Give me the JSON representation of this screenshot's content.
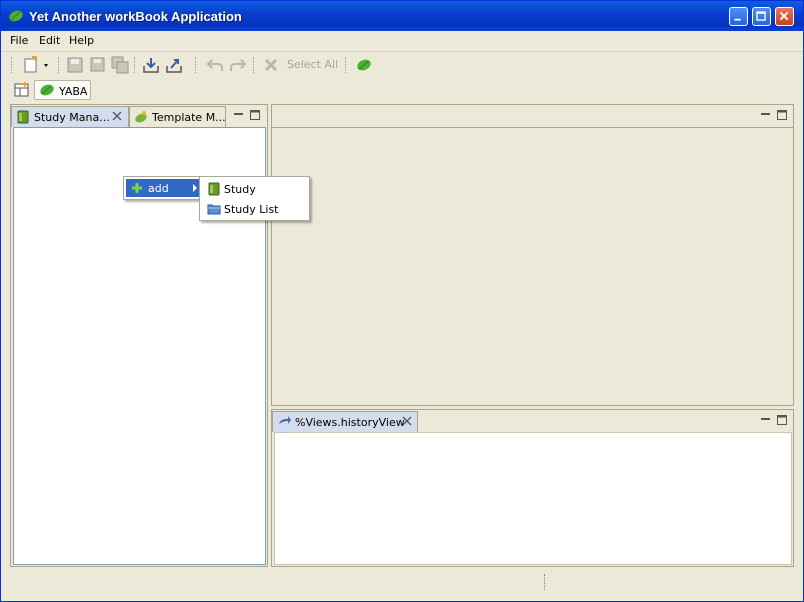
{
  "window": {
    "title": "Yet Another workBook Application",
    "controls": [
      "minimize",
      "maximize",
      "close"
    ]
  },
  "menubar": {
    "items": [
      {
        "label": "File"
      },
      {
        "label": "Edit"
      },
      {
        "label": "Help"
      }
    ]
  },
  "toolbar": {
    "select_all_label": "Select All",
    "icons": [
      "new-dropdown-icon",
      "save-icon",
      "save-as-icon",
      "save-all-icon",
      "import-icon",
      "export-icon",
      "undo-icon",
      "redo-icon",
      "delete-icon",
      "leaf-icon"
    ]
  },
  "perspective": {
    "open_perspective_icon": "open-perspective-icon",
    "active_label": "YABA"
  },
  "left_panel": {
    "tabs": [
      {
        "label": "Study Mana...",
        "icon": "study-icon",
        "active": true
      },
      {
        "label": "Template M...",
        "icon": "leaf-icon",
        "active": false
      }
    ]
  },
  "history_panel": {
    "tab": {
      "label": "%Views.historyView",
      "icon": "history-icon"
    }
  },
  "context_menu": {
    "item": {
      "label": "add",
      "icon": "plus-icon"
    },
    "submenu": [
      {
        "label": "Study",
        "icon": "study-icon"
      },
      {
        "label": "Study List",
        "icon": "folder-icon"
      }
    ]
  },
  "colors": {
    "title_bar": "#0a4fd6",
    "chrome": "#ece9d8",
    "selection": "#316ac5",
    "active_tab": "#d4dced"
  }
}
